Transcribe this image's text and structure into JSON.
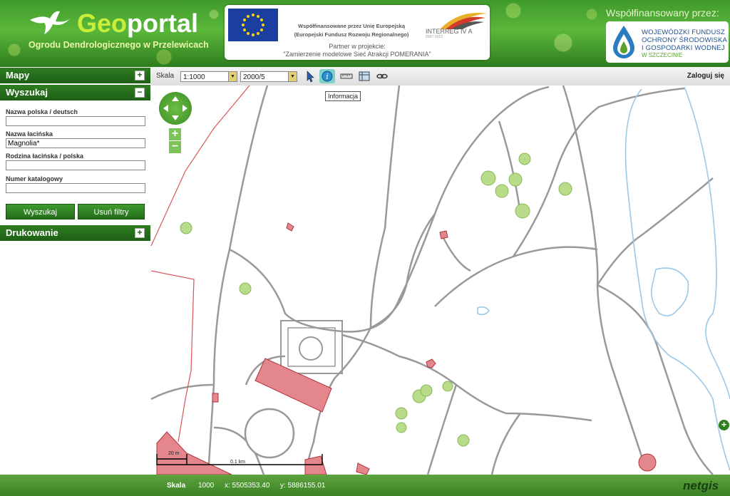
{
  "header": {
    "title_part1": "Geo",
    "title_part2": "portal",
    "subtitle": "Ogrodu Dendrologicznego w Przelewicach",
    "eu_line1": "Współfinansowane przez Unię Europejską",
    "eu_line2": "(Europejski Fundusz Rozwoju Regionalnego)",
    "interreg": "INTERREG IV A",
    "interreg_small": "2007-2013",
    "partner_label": "Partner w projekcie:",
    "project_name": "\"Zamierzenie modelowe Sieć Atrakcji POMERANIA\"",
    "cofinanced_label": "Współfinansowany przez:",
    "fund_line1": "WOJEWÓDZKI FUNDUSZ",
    "fund_line2": "OCHRONY ŚRODOWISKA",
    "fund_line3": "I GOSPODARKI WODNEJ",
    "fund_line4": "W SZCZECINIE"
  },
  "sidebar": {
    "maps_label": "Mapy",
    "search_label": "Wyszukaj",
    "print_label": "Drukowanie",
    "fields": [
      {
        "label": "Nazwa polska / deutsch",
        "value": ""
      },
      {
        "label": "Nazwa łacińska",
        "value": "Magnolia*"
      },
      {
        "label": "Rodzina łacińska / polska",
        "value": ""
      },
      {
        "label": "Numer katalogowy",
        "value": ""
      }
    ],
    "search_button": "Wyszukaj",
    "clear_button": "Usuń filtry",
    "expand_symbol": "+",
    "collapse_symbol": "−"
  },
  "toolbar": {
    "scale_label": "Skala",
    "scale_value": "1:1000",
    "layer_value": "2000/5",
    "login": "Zaloguj się",
    "tooltip": "Informacja",
    "tools": [
      "select-arrow-icon",
      "info-icon",
      "measure-ruler-icon",
      "area-measure-icon",
      "link-icon"
    ]
  },
  "map": {
    "scalebar_20m": "20 m",
    "scalebar_01km": "0.1 km",
    "zoom_in": "+",
    "zoom_out": "−",
    "expand": "+"
  },
  "footer": {
    "scale_label": "Skala",
    "scale_value": "1000",
    "x": "x: 5505353.40",
    "y": "y: 5886155.01",
    "brand": "netgis"
  },
  "colors": {
    "header_green": "#3f9a2b",
    "panel_green": "#2e7d21",
    "building_fill": "#e4878c",
    "path_stroke": "#999999",
    "water_stroke": "#9cc8e8"
  }
}
